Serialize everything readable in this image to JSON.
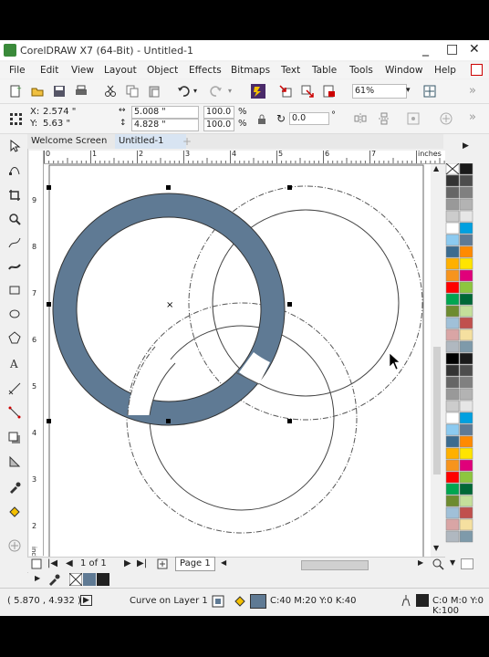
{
  "window": {
    "title": "CorelDRAW X7 (64-Bit) - Untitled-1",
    "controls": [
      "_",
      "□",
      "✕"
    ]
  },
  "menu": {
    "items": [
      "File",
      "Edit",
      "View",
      "Layout",
      "Object",
      "Effects",
      "Bitmaps",
      "Text",
      "Table",
      "Tools",
      "Window",
      "Help"
    ]
  },
  "toolbar": {
    "zoom_value": "61%"
  },
  "property_bar": {
    "x_label": "X:",
    "x_value": "2.574 \"",
    "y_label": "Y:",
    "y_value": "5.63 \"",
    "width_value": "5.008 \"",
    "height_value": "4.828 \"",
    "scale_w": "100.0",
    "scale_h": "100.0",
    "percent": "%",
    "rotation_value": "0.0",
    "degree": "°"
  },
  "tabs": [
    {
      "label": "Welcome Screen"
    },
    {
      "label": "Untitled-1"
    }
  ],
  "ruler": {
    "h_ticks": [
      "0",
      "1",
      "2",
      "3",
      "4",
      "5",
      "6",
      "7",
      "8"
    ],
    "h_unit": "inches",
    "v_ticks": [
      "9",
      "8",
      "7",
      "6",
      "5",
      "4",
      "3",
      "2",
      "1"
    ],
    "v_unit": "inches"
  },
  "page_nav": {
    "page_label": "1 of 1",
    "page_tab": "Page 1"
  },
  "status": {
    "coords": "( 5.870 , 4.932 )",
    "object_info": "Curve on Layer 1",
    "fill_values": "C:40 M:20 Y:0 K:40",
    "outline_values": "C:0 M:0 Y:0 K:100"
  },
  "colors": {
    "selected_fill": "#5f7a94",
    "palette": [
      "#000000",
      "#1a1a1a",
      "#333333",
      "#4d4d4d",
      "#666666",
      "#808080",
      "#999999",
      "#b3b3b3",
      "#cccccc",
      "#e6e6e6",
      "#ffffff",
      "#00a0e0",
      "#8ccaf0",
      "#5f7a94",
      "#3b6b8f",
      "#ff8a00",
      "#ffb000",
      "#ffe400",
      "#f7941d",
      "#e0007a",
      "#ff0000",
      "#8dc63f",
      "#00a651",
      "#006837",
      "#6d8b30",
      "#c4df9b",
      "#a0c0d8",
      "#c0504d",
      "#d9a5a5",
      "#f5e0a0",
      "#b0b8c0",
      "#7e9aaa"
    ]
  }
}
